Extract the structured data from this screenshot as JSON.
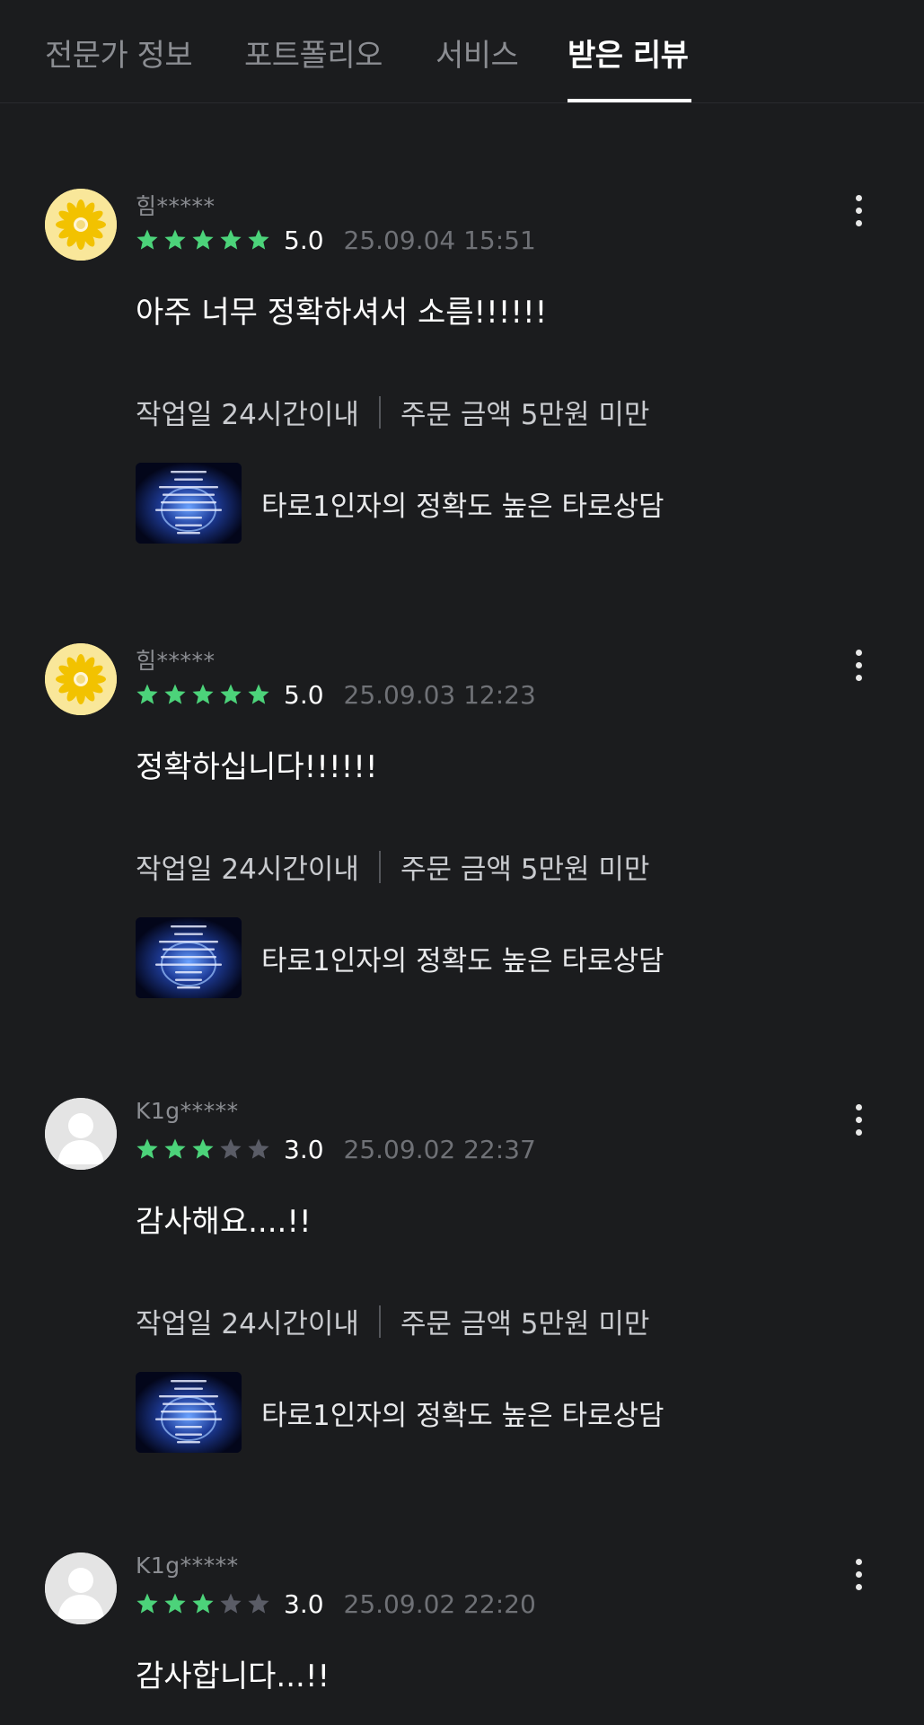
{
  "tabs": [
    {
      "label": "전문가 정보",
      "active": false
    },
    {
      "label": "포트폴리오",
      "active": false
    },
    {
      "label": "서비스",
      "active": false
    },
    {
      "label": "받은 리뷰",
      "active": true
    }
  ],
  "colors": {
    "background": "#1b1c1e",
    "star_filled": "#4cd37a",
    "star_empty": "#5a5c66",
    "muted_text": "#8b8d92"
  },
  "reviews": [
    {
      "username": "힘*****",
      "avatar": "flower-avatar",
      "rating": 5,
      "score": "5.0",
      "date": "25.09.04 15:51",
      "comment": "아주 너무 정확하셔서 소름!!!!!!",
      "work_days": "작업일 24시간이내",
      "order_amount": "주문 금액 5만원 미만",
      "service_title": "타로1인자의 정확도 높은 타로상담"
    },
    {
      "username": "힘*****",
      "avatar": "flower-avatar",
      "rating": 5,
      "score": "5.0",
      "date": "25.09.03 12:23",
      "comment": "정확하십니다!!!!!!",
      "work_days": "작업일 24시간이내",
      "order_amount": "주문 금액 5만원 미만",
      "service_title": "타로1인자의 정확도 높은 타로상담"
    },
    {
      "username": "K1g*****",
      "avatar": "default-user-avatar",
      "rating": 3,
      "score": "3.0",
      "date": "25.09.02 22:37",
      "comment": "감사해요....!!",
      "work_days": "작업일 24시간이내",
      "order_amount": "주문 금액 5만원 미만",
      "service_title": "타로1인자의 정확도 높은 타로상담"
    },
    {
      "username": "K1g*****",
      "avatar": "default-user-avatar",
      "rating": 3,
      "score": "3.0",
      "date": "25.09.02 22:20",
      "comment": "감사합니다...!!"
    }
  ]
}
